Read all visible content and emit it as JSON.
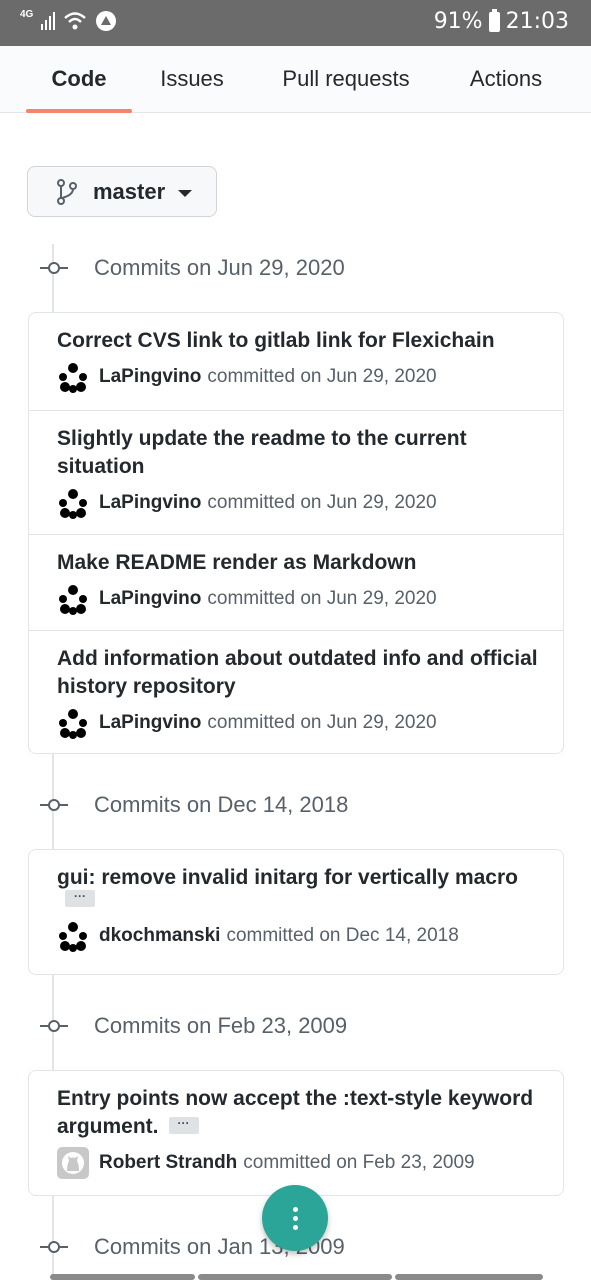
{
  "status_bar": {
    "network": "4G",
    "battery": "91%",
    "time": "21:03"
  },
  "tabs": [
    {
      "label": "Code",
      "active": true
    },
    {
      "label": "Issues",
      "active": false
    },
    {
      "label": "Pull requests",
      "active": false
    },
    {
      "label": "Actions",
      "active": false
    }
  ],
  "branch": {
    "name": "master",
    "icon": "git-branch-icon"
  },
  "groups": [
    {
      "title": "Commits on Jun 29, 2020",
      "commits": [
        {
          "message": "Correct CVS link to gitlab link for Flexichain",
          "author": "LaPingvino",
          "committed": "committed on Jun 29, 2020",
          "avatar": "identicon",
          "has_more": false
        },
        {
          "message": "Slightly update the readme to the current situation",
          "author": "LaPingvino",
          "committed": "committed on Jun 29, 2020",
          "avatar": "identicon",
          "has_more": false
        },
        {
          "message": "Make README render as Markdown",
          "author": "LaPingvino",
          "committed": "committed on Jun 29, 2020",
          "avatar": "identicon",
          "has_more": false
        },
        {
          "message": "Add information about outdated info and official history repository",
          "author": "LaPingvino",
          "committed": "committed on Jun 29, 2020",
          "avatar": "identicon",
          "has_more": false
        }
      ]
    },
    {
      "title": "Commits on Dec 14, 2018",
      "commits": [
        {
          "message": "gui: remove invalid initarg for vertically macro",
          "author": "dkochmanski",
          "committed": "committed on Dec 14, 2018",
          "avatar": "identicon",
          "has_more": true
        }
      ]
    },
    {
      "title": "Commits on Feb 23, 2009",
      "commits": [
        {
          "message": "Entry points now accept the :text-style keyword argument.",
          "author": "Robert Strandh",
          "committed": "committed on Feb 23, 2009",
          "avatar": "github-octocat",
          "has_more": true
        }
      ]
    },
    {
      "title": "Commits on Jan 13, 2009",
      "commits": []
    }
  ],
  "fab": {
    "icon": "more-vertical-icon"
  },
  "colors": {
    "tab_underline": "#f9826c",
    "fab": "#2ba597",
    "status_bar": "#6b6b6b"
  }
}
